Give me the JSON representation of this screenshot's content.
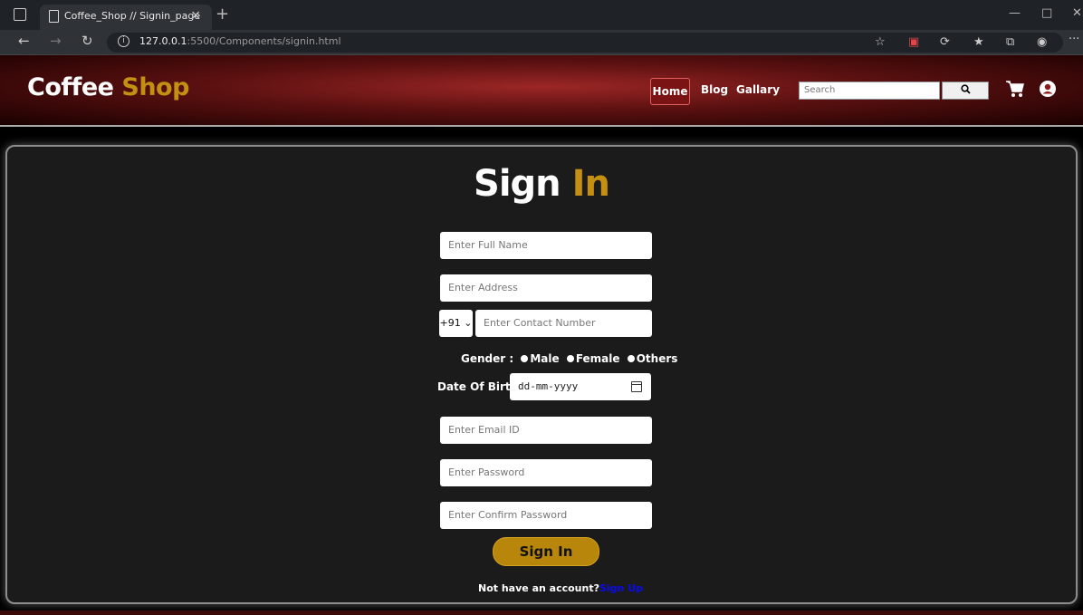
{
  "browser": {
    "tab_title": "Coffee_Shop // Signin_page",
    "tab_close": "×",
    "new_tab": "+",
    "url_host": "127.0.0.1",
    "url_rest": ":5500/Components/signin.html",
    "more": "···"
  },
  "header": {
    "logo_main": "Coffee",
    "logo_accent": "Shop",
    "nav": {
      "home": "Home",
      "blog": "Blog",
      "gallery": "Gallary"
    },
    "search_placeholder": "Search",
    "search_icon": "search-icon",
    "cart_icon": "cart-icon",
    "user_icon": "user-icon"
  },
  "form": {
    "heading_main": "Sign",
    "heading_accent": "In",
    "full_name_placeholder": "Enter Full Name",
    "address_placeholder": "Enter Address",
    "country_code": "+91",
    "contact_placeholder": "Enter Contact Number",
    "gender_label": "Gender :",
    "gender_options": [
      "Male",
      "Female",
      "Others"
    ],
    "dob_label": "Date Of Birth:",
    "dob_placeholder": "dd-mm-yyyy",
    "email_placeholder": "Enter Email ID",
    "password_placeholder": "Enter Password",
    "confirm_password_placeholder": "Enter Confirm Password",
    "submit_label": "Sign In",
    "footer_text": "Not have an account?",
    "signup_link": "Sign Up"
  },
  "colors": {
    "accent": "#c49012",
    "header_red": "#9c2626",
    "card_bg": "#1b1b1b",
    "link": "#0a0aee"
  }
}
